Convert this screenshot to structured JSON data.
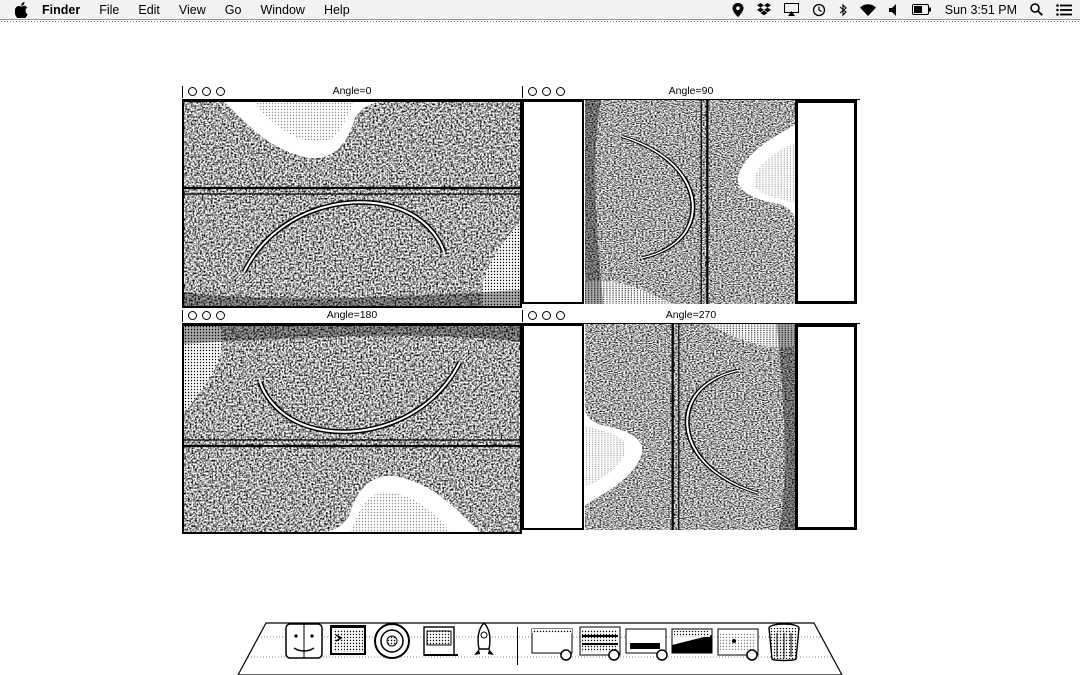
{
  "menubar": {
    "app_name": "Finder",
    "menus": [
      "File",
      "Edit",
      "View",
      "Go",
      "Window",
      "Help"
    ],
    "clock": "Sun 3:51 PM",
    "status_icons": [
      "location-icon",
      "dropbox-icon",
      "airplay-icon",
      "time-machine-icon",
      "bluetooth-icon",
      "wifi-icon",
      "volume-icon",
      "battery-icon",
      "spotlight-icon",
      "notification-center-icon"
    ]
  },
  "windows": [
    {
      "title": "Angle=0",
      "rotation": 0
    },
    {
      "title": "Angle=90",
      "rotation": 90
    },
    {
      "title": "Angle=180",
      "rotation": 180
    },
    {
      "title": "Angle=270",
      "rotation": 270
    }
  ],
  "dock": {
    "items": [
      "finder-icon",
      "terminal-icon",
      "itunes-icon",
      "preview-icon",
      "launchpad-rocket-icon",
      "window-thumbnail-icon",
      "window-thumbnail-icon",
      "window-thumbnail-icon",
      "window-thumbnail-icon",
      "window-thumbnail-icon",
      "trash-icon"
    ]
  },
  "colors": {
    "background": "#ffffff",
    "foreground": "#000000"
  }
}
